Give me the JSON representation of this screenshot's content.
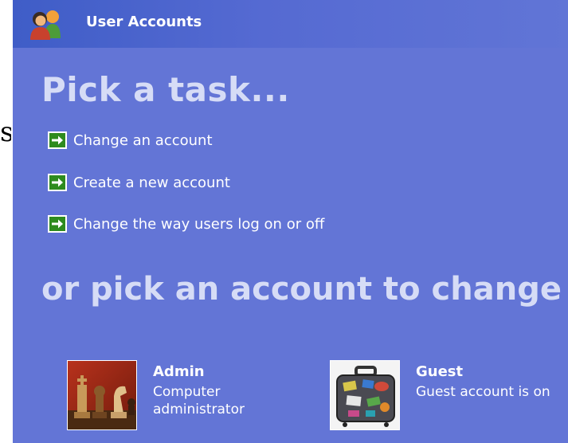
{
  "window": {
    "title": "User Accounts",
    "background_color": "#6375d6",
    "titlebar_icon": "user-accounts-icon"
  },
  "edge_glyph": "s",
  "heading": "Pick a task...",
  "tasks": [
    {
      "label": "Change an account",
      "icon": "green-arrow-icon"
    },
    {
      "label": "Create a new account",
      "icon": "green-arrow-icon"
    },
    {
      "label": "Change the way users log on or off",
      "icon": "green-arrow-icon"
    }
  ],
  "subheading": "or pick an account to change",
  "accounts": [
    {
      "name": "Admin",
      "description": "Computer administrator",
      "picture": "chess-pieces-picture"
    },
    {
      "name": "Guest",
      "description": "Guest account is on",
      "picture": "suitcase-picture"
    }
  ]
}
